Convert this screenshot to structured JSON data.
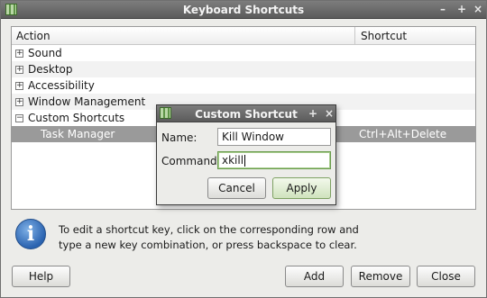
{
  "window": {
    "title": "Keyboard Shortcuts",
    "controls": {
      "minimize": "–",
      "maximize": "+",
      "close": "×"
    }
  },
  "tree": {
    "headers": {
      "action": "Action",
      "shortcut": "Shortcut"
    },
    "rows": [
      {
        "label": "Sound",
        "expander": "+"
      },
      {
        "label": "Desktop",
        "expander": "+"
      },
      {
        "label": "Accessibility",
        "expander": "+"
      },
      {
        "label": "Window Management",
        "expander": "+"
      },
      {
        "label": "Custom Shortcuts",
        "expander": "−"
      },
      {
        "label": "Task Manager",
        "shortcut": "Ctrl+Alt+Delete"
      }
    ]
  },
  "info": {
    "icon": "i",
    "text_line1": "To edit a shortcut key, click on the corresponding row and",
    "text_line2": "type a new key combination, or press backspace to clear."
  },
  "buttons": {
    "help": "Help",
    "add": "Add",
    "remove": "Remove",
    "close": "Close"
  },
  "dialog": {
    "title": "Custom Shortcut",
    "controls": {
      "maximize": "+",
      "close": "×"
    },
    "name_label": "Name:",
    "name_value": "Kill Window",
    "command_label": "Command:",
    "command_value": "xkill",
    "cancel_label": "Cancel",
    "apply_label": "Apply"
  }
}
